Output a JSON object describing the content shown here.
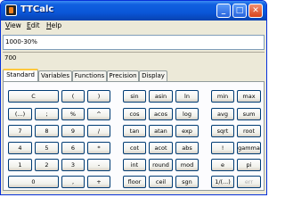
{
  "window": {
    "title": "TTCalc"
  },
  "titlebar": {
    "minimize": "_",
    "maximize": "□",
    "close": "✕"
  },
  "menu": [
    {
      "underline": "V",
      "rest": "iew"
    },
    {
      "underline": "E",
      "rest": "dit"
    },
    {
      "underline": "H",
      "rest": "elp"
    }
  ],
  "expression": {
    "value": "1000-30%"
  },
  "result": {
    "value": "700"
  },
  "tabs": [
    "Standard",
    "Variables",
    "Functions",
    "Precision",
    "Display"
  ],
  "active_tab": "Standard",
  "keypad": {
    "basic": [
      [
        "C",
        "(",
        ")"
      ],
      [
        "(...)",
        ";",
        "%",
        "^"
      ],
      [
        "7",
        "8",
        "9",
        "/"
      ],
      [
        "4",
        "5",
        "6",
        "*"
      ],
      [
        "1",
        "2",
        "3",
        "-"
      ],
      [
        "0",
        ",",
        "+"
      ]
    ],
    "functions": [
      [
        "sin",
        "asin",
        "ln"
      ],
      [
        "cos",
        "acos",
        "log"
      ],
      [
        "tan",
        "atan",
        "exp"
      ],
      [
        "cot",
        "acot",
        "abs"
      ],
      [
        "int",
        "round",
        "mod"
      ],
      [
        "floor",
        "ceil",
        "sgn"
      ]
    ],
    "extra": [
      [
        "min",
        "max"
      ],
      [
        "avg",
        "sum"
      ],
      [
        "sqrt",
        "root"
      ],
      [
        "!",
        "gamma"
      ],
      [
        "e",
        "pi"
      ],
      [
        "1/(...)",
        "err"
      ]
    ]
  }
}
